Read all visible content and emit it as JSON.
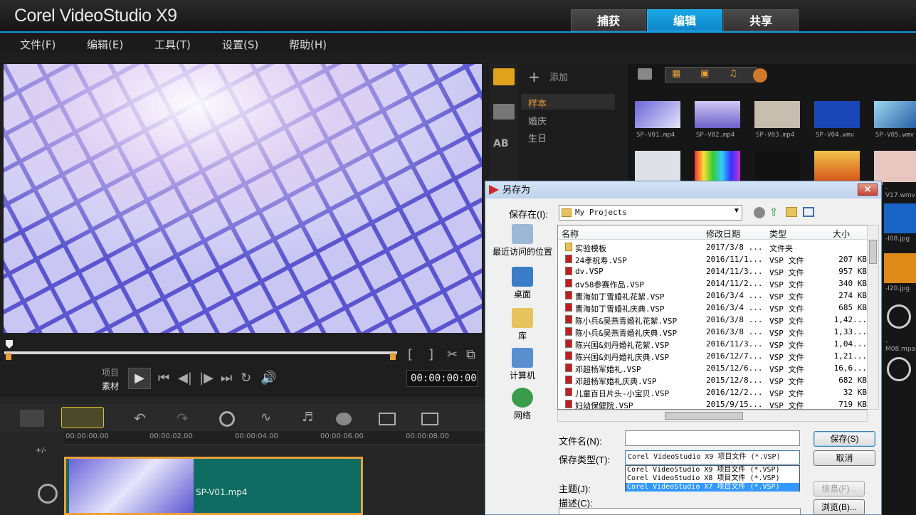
{
  "app": {
    "title": "Corel VideoStudio X9"
  },
  "tabs": [
    {
      "label": "捕获"
    },
    {
      "label": "编辑"
    },
    {
      "label": "共享"
    }
  ],
  "menu": [
    "文件(F)",
    "编辑(E)",
    "工具(T)",
    "设置(S)",
    "帮助(H)"
  ],
  "player": {
    "mode_project": "项目",
    "mode_clip": "素材",
    "timecode": "00:00:00:00",
    "in_mark": "[",
    "out_mark": "]"
  },
  "library": {
    "add_label": "添加",
    "categories": [
      "样本",
      "婚庆",
      "生日"
    ],
    "thumbs": [
      "SP-V01.mp4",
      "SP-V02.mp4",
      "SP-V03.mp4",
      "SP-V04.wmv",
      "SP-V05.wmv"
    ],
    "side_labels": [
      "-V17.wmv",
      "-I08.jpg",
      "-I20.jpg",
      "-M08.mpa"
    ]
  },
  "timeline": {
    "ruler": [
      "00:00:00.00",
      "00:00:02.00",
      "00:00:04.00",
      "00:00:06.00",
      "00:00:08.00"
    ],
    "zoom": "+/-",
    "clip_name": "SP-V01.mp4"
  },
  "dialog": {
    "title": "另存为",
    "save_in_label": "保存在(I):",
    "save_in_value": "My Projects",
    "places": [
      "最近访问的位置",
      "桌面",
      "库",
      "计算机",
      "网络"
    ],
    "columns": [
      "名称",
      "修改日期",
      "类型",
      "大小"
    ],
    "files": [
      {
        "name": "实验模板",
        "date": "2017/3/8 ...",
        "type": "文件夹",
        "size": "",
        "folder": true
      },
      {
        "name": "24孝祝寿.VSP",
        "date": "2016/11/1...",
        "type": "VSP 文件",
        "size": "207 KB"
      },
      {
        "name": "dv.VSP",
        "date": "2014/11/3...",
        "type": "VSP 文件",
        "size": "957 KB"
      },
      {
        "name": "dv58参赛作品.VSP",
        "date": "2014/11/2...",
        "type": "VSP 文件",
        "size": "340 KB"
      },
      {
        "name": "曹海如丁雪婚礼花絮.VSP",
        "date": "2016/3/4 ...",
        "type": "VSP 文件",
        "size": "274 KB"
      },
      {
        "name": "曹海如丁雪婚礼庆典.VSP",
        "date": "2016/3/4 ...",
        "type": "VSP 文件",
        "size": "685 KB"
      },
      {
        "name": "陈小兵&吴燕青婚礼花絮.VSP",
        "date": "2016/3/8 ...",
        "type": "VSP 文件",
        "size": "1,42..."
      },
      {
        "name": "陈小兵&吴燕青婚礼庆典.VSP",
        "date": "2016/3/8 ...",
        "type": "VSP 文件",
        "size": "1,33..."
      },
      {
        "name": "陈兴国&刘丹婚礼花絮.VSP",
        "date": "2016/11/3...",
        "type": "VSP 文件",
        "size": "1,04..."
      },
      {
        "name": "陈兴国&刘丹婚礼庆典.VSP",
        "date": "2016/12/7...",
        "type": "VSP 文件",
        "size": "1,21..."
      },
      {
        "name": "邓超杨军婚礼.VSP",
        "date": "2015/12/6...",
        "type": "VSP 文件",
        "size": "16,6..."
      },
      {
        "name": "邓超杨军婚礼庆典.VSP",
        "date": "2015/12/8...",
        "type": "VSP 文件",
        "size": "682 KB"
      },
      {
        "name": "儿童百日片头-小宝贝.VSP",
        "date": "2016/12/2...",
        "type": "VSP 文件",
        "size": "32 KB"
      },
      {
        "name": "妇幼保健院.VSP",
        "date": "2015/9/15...",
        "type": "VSP 文件",
        "size": "719 KB"
      }
    ],
    "filename_label": "文件名(N):",
    "filename_value": "",
    "type_label": "保存类型(T):",
    "type_value": "Corel VideoStudio X9 项目文件 (*.VSP)",
    "type_options": [
      "Corel VideoStudio X9 项目文件 (*.VSP)",
      "Corel VideoStudio X8 项目文件 (*.VSP)",
      "Corel VideoStudio X7 项目文件 (*.VSP)"
    ],
    "subject_label": "主题(J):",
    "desc_label": "描述(C):",
    "save_btn": "保存(S)",
    "cancel_btn": "取消",
    "info_btn": "信息(F)...",
    "browse_btn": "浏览(B)..."
  }
}
